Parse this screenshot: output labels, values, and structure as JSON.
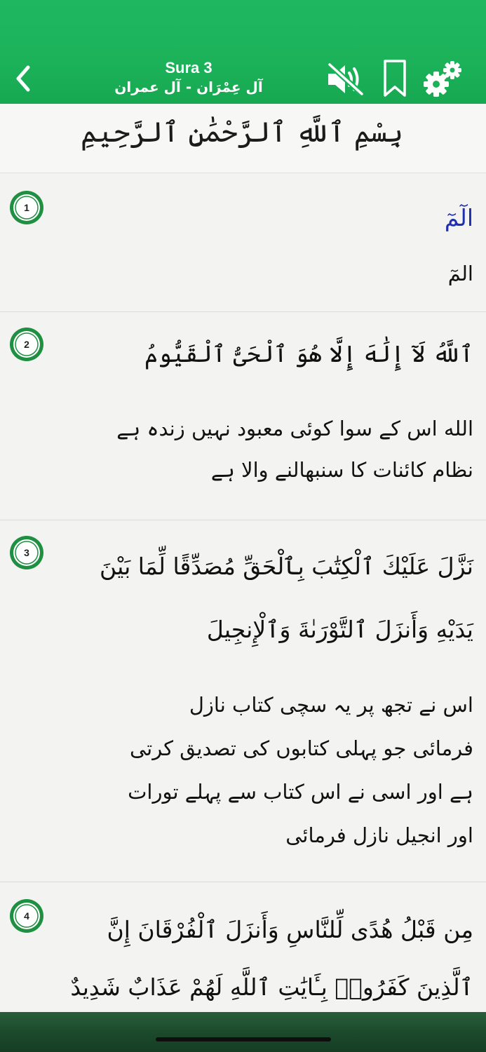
{
  "header": {
    "title": "Sura 3",
    "subtitle": "آل عِمْرَان - آل عمران",
    "accent_color": "#1bb25a",
    "icons": [
      "back-chevron-icon",
      "sound-muted-icon",
      "bookmark-icon",
      "settings-gears-icon"
    ]
  },
  "bismillah": {
    "text": "بِسْمِ ٱللَّهِ ٱلرَّحْمَٰنِ ٱلرَّحِيمِ"
  },
  "verses": [
    {
      "number": "1",
      "arabic": [
        "الٓمٓ"
      ],
      "translation": "المٓ"
    },
    {
      "number": "2",
      "arabic": [
        "ٱللَّهُ لَآ إِلَٰهَ إِلَّا هُوَ ٱلْحَىُّ ٱلْقَيُّومُ"
      ],
      "translation": [
        "الله اس کے سوا کوئی معبود نہیں زندہ ہے",
        "نظام کائنات کا سنبھالنے والا ہے"
      ]
    },
    {
      "number": "3",
      "arabic": [
        "نَزَّلَ عَلَيْكَ ٱلْكِتَٰبَ بِٱلْحَقِّ مُصَدِّقًا لِّمَا بَيْنَ",
        "يَدَيْهِ وَأَنزَلَ ٱلتَّوْرَىٰةَ وَٱلْإِنجِيلَ"
      ],
      "translation": [
        "اس نے تجھ پر یہ سچی کتاب نازل",
        "فرمائی جو پہلی کتابوں کی تصدیق کرتی",
        "ہے اور اسی نے اس کتاب سے پہلے تورات",
        "اور انجیل نازل فرمائی"
      ]
    },
    {
      "number": "4",
      "arabic": [
        "مِن قَبْلُ هُدًى لِّلنَّاسِ وَأَنزَلَ ٱلْفُرْقَانَ إِنَّ",
        "ٱلَّذِينَ كَفَرُوا۟ بِـَٔايَٰتِ ٱللَّهِ لَهُمْ عَذَابٌ شَدِيدٌ"
      ]
    }
  ]
}
